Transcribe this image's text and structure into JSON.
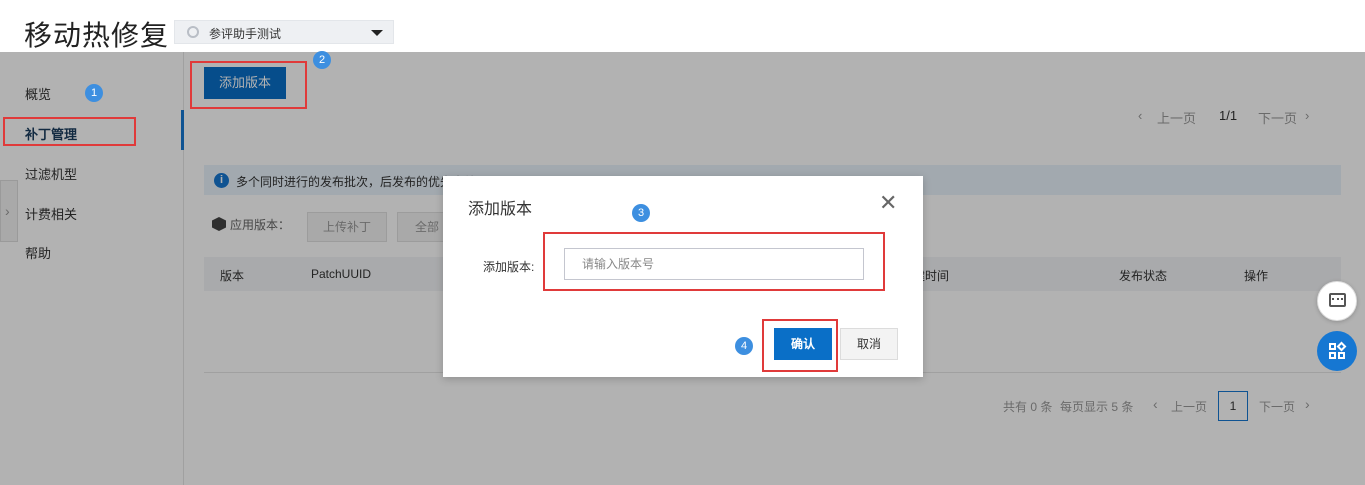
{
  "header": {
    "title": "移动热修复",
    "app_selector": "参评助手测试"
  },
  "sidebar": {
    "items": [
      {
        "label": "概览"
      },
      {
        "label": "补丁管理"
      },
      {
        "label": "过滤机型"
      },
      {
        "label": "计费相关"
      },
      {
        "label": "帮助"
      }
    ],
    "collapse_glyph": "›"
  },
  "main": {
    "add_version_button": "添加版本",
    "pager_top": {
      "prev": "上一页",
      "page": "1/1",
      "next": "下一页"
    },
    "notice": "多个同时进行的发布批次，后发布的优先生效",
    "version_label": "应用版本：",
    "upload_patch_button": "上传补丁",
    "all_button": "全部",
    "table_headers": [
      "版本",
      "PatchUUID",
      "创建时间",
      "发布状态",
      "操作"
    ],
    "pager_bottom": {
      "total": "共有 0 条",
      "per_page": "每页显示 5 条",
      "prev": "上一页",
      "page": "1",
      "next": "下一页"
    }
  },
  "dialog": {
    "title": "添加版本",
    "close_glyph": "✕",
    "field_label": "添加版本:",
    "input_placeholder": "请输入版本号",
    "ok_button": "确认",
    "cancel_button": "取消"
  },
  "annotations": {
    "steps": [
      "1",
      "2",
      "3",
      "4"
    ],
    "highlight_color": "#e03a3a",
    "step_color": "#3d8fe0"
  },
  "colors": {
    "primary": "#0a6fc7",
    "overlay": "rgba(0,0,0,0.30)"
  }
}
